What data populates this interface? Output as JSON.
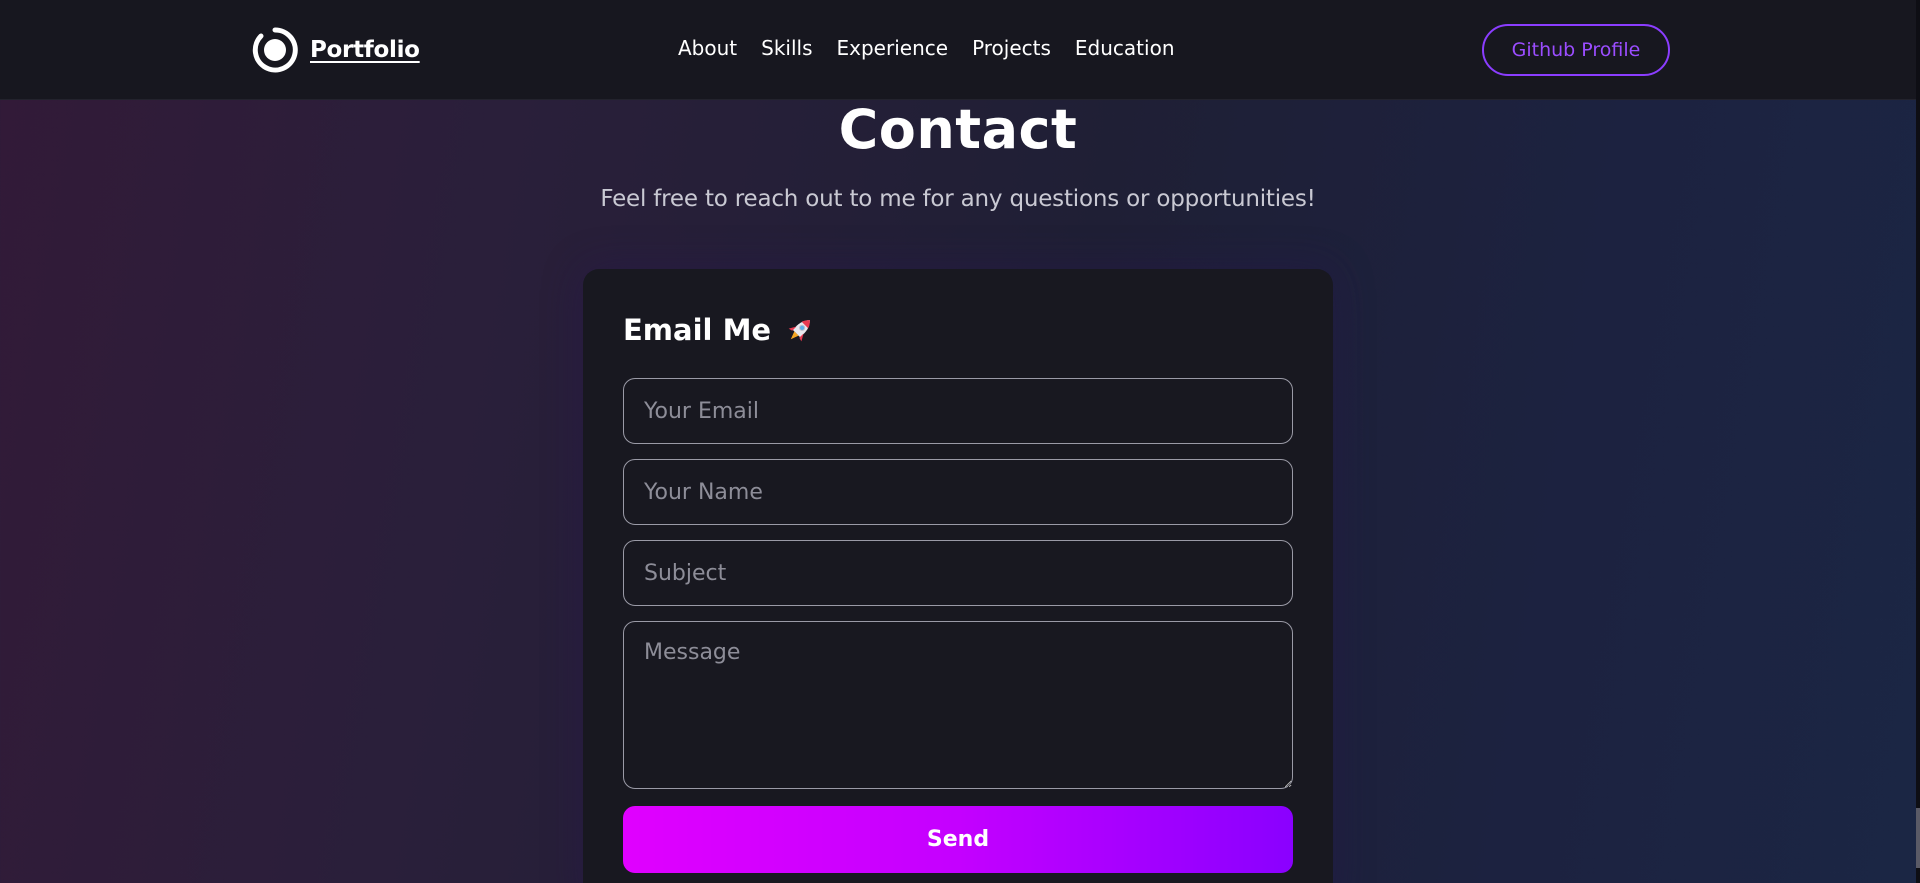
{
  "nav": {
    "logo_text": "Portfolio",
    "links": [
      "About",
      "Skills",
      "Experience",
      "Projects",
      "Education"
    ],
    "github_label": "Github Profile"
  },
  "contact": {
    "title": "Contact",
    "description": "Feel free to reach out to me for any questions or opportunities!"
  },
  "form": {
    "title": "Email Me",
    "title_icon": "rocket-icon",
    "email_placeholder": "Your Email",
    "name_placeholder": "Your Name",
    "subject_placeholder": "Subject",
    "message_placeholder": "Message",
    "send_label": "Send"
  },
  "colors": {
    "accent": "#8b3dff",
    "send_gradient_start": "#e000ff",
    "send_gradient_end": "#8a00ff",
    "navbar_bg": "#17171f",
    "card_bg": "#181820"
  }
}
